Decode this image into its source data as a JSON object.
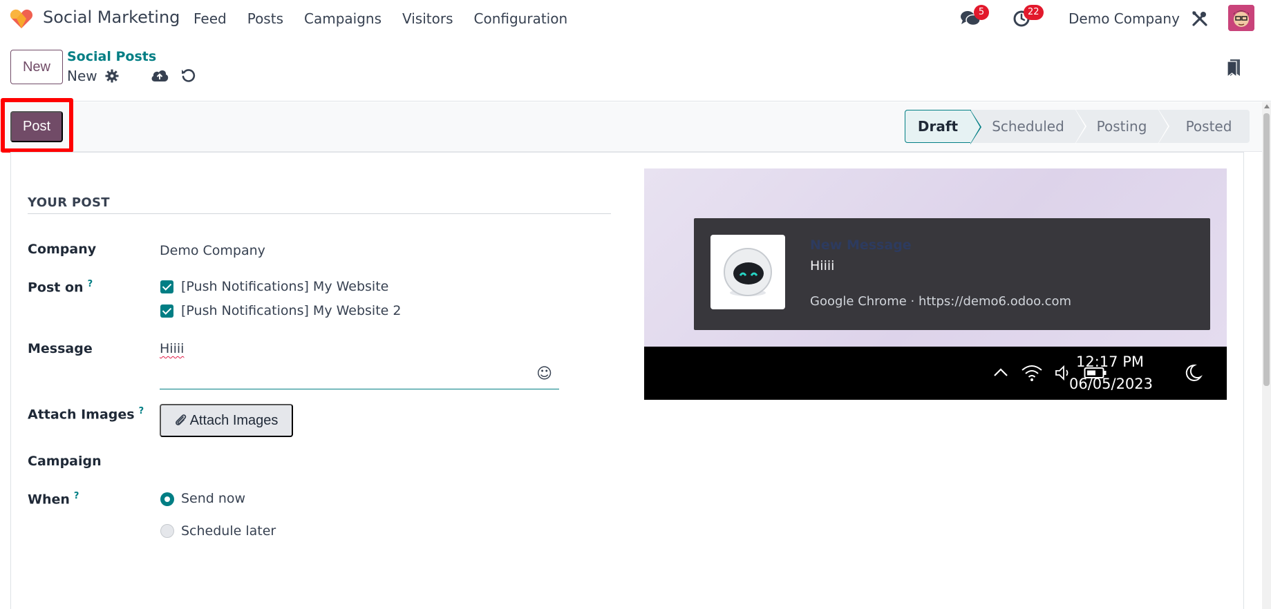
{
  "navbar": {
    "app_name": "Social Marketing",
    "menu": [
      "Feed",
      "Posts",
      "Campaigns",
      "Visitors",
      "Configuration"
    ],
    "messages_count": "5",
    "activities_count": "22",
    "company": "Demo Company"
  },
  "control_panel": {
    "new_label": "New",
    "breadcrumb_parent": "Social Posts",
    "breadcrumb_current": "New"
  },
  "statusbar": {
    "post_label": "Post",
    "stages": [
      "Draft",
      "Scheduled",
      "Posting",
      "Posted"
    ],
    "active_stage": "Draft"
  },
  "form": {
    "section_title": "YOUR POST",
    "company_label": "Company",
    "company_value": "Demo Company",
    "post_on_label": "Post on",
    "help_mark": "?",
    "accounts": [
      "[Push Notifications] My Website",
      "[Push Notifications] My Website 2"
    ],
    "message_label": "Message",
    "message_value": "Hiiii",
    "attach_label": "Attach Images",
    "attach_button": "Attach Images",
    "campaign_label": "Campaign",
    "when_label": "When",
    "when_options": [
      "Send now",
      "Schedule later"
    ],
    "when_selected": "Send now"
  },
  "preview": {
    "notification_title": "New Message",
    "notification_body": "Hiiii",
    "notification_source": "Google Chrome · https://demo6.odoo.com",
    "time": "12:17 PM",
    "date": "06/05/2023"
  },
  "colors": {
    "brand": "#714b67",
    "accent": "#017e84",
    "highlight": "#ff0000",
    "badge": "#e2192c"
  }
}
